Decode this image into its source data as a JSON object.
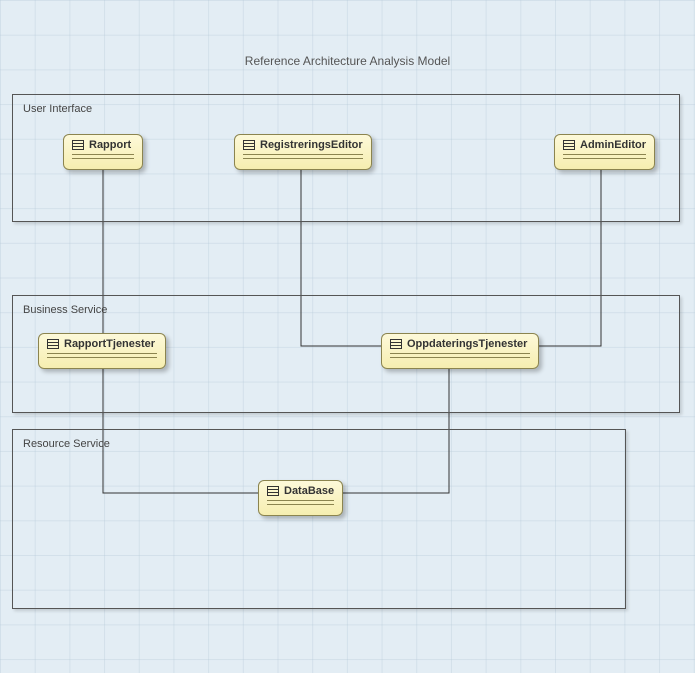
{
  "title": "Reference Architecture Analysis Model",
  "layers": {
    "ui": {
      "label": "User Interface"
    },
    "business": {
      "label": "Business Service"
    },
    "resource": {
      "label": "Resource Service"
    }
  },
  "classes": {
    "rapport": {
      "name": "Rapport"
    },
    "registreringsEditor": {
      "name": "RegistreringsEditor"
    },
    "adminEditor": {
      "name": "AdminEditor"
    },
    "rapportTjenester": {
      "name": "RapportTjenester"
    },
    "oppdateringsTjenester": {
      "name": "OppdateringsTjenester"
    },
    "database": {
      "name": "DataBase"
    }
  }
}
